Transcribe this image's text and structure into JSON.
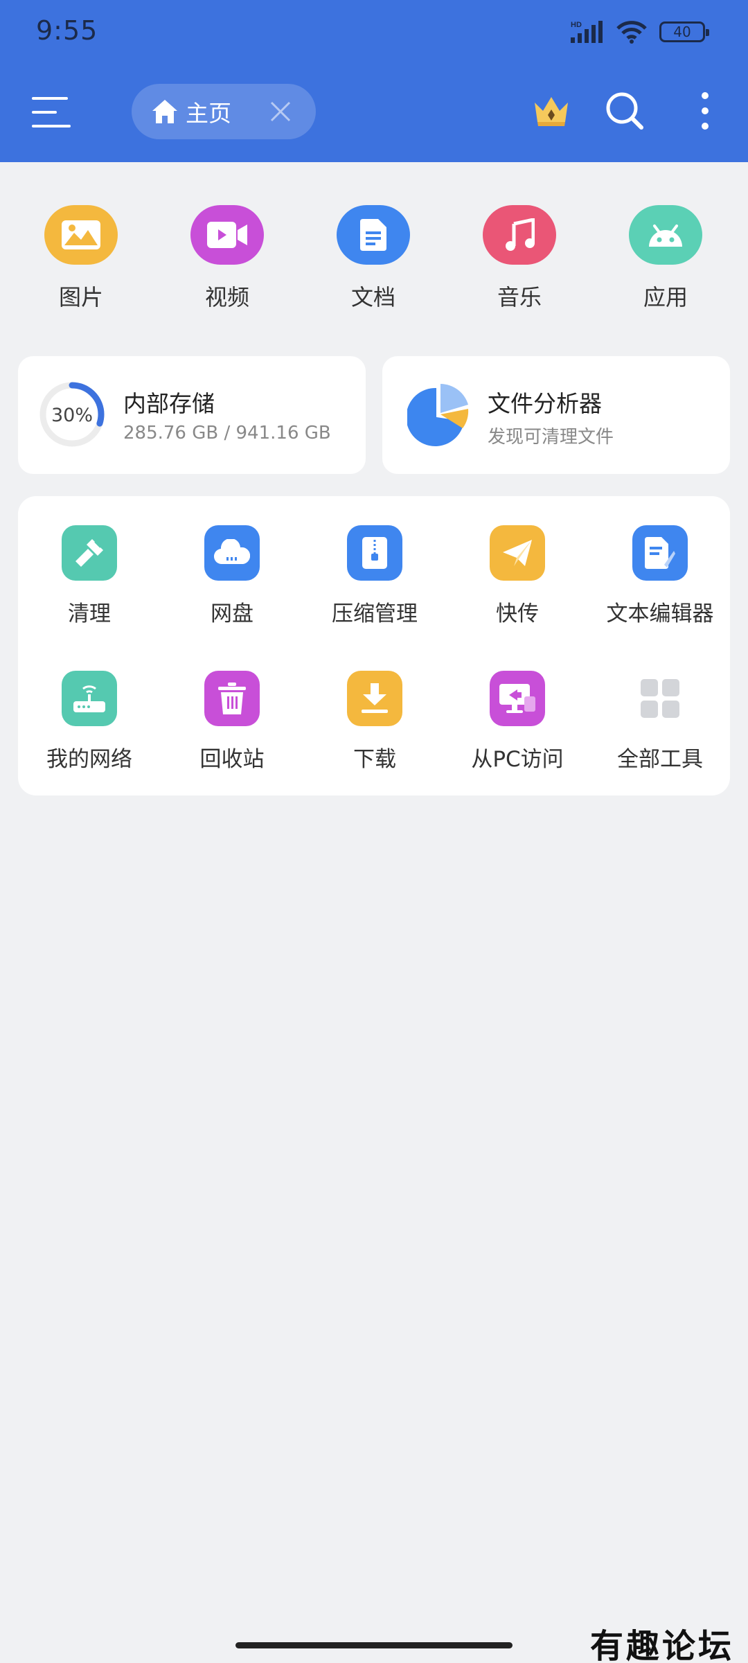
{
  "status_bar": {
    "time": "9:55",
    "battery": "40",
    "network": "HD"
  },
  "header": {
    "tab_label": "主页",
    "icons": [
      "menu-icon",
      "home-icon",
      "close-icon",
      "crown-icon",
      "search-icon",
      "more-vert-icon"
    ],
    "background": "#3d72de"
  },
  "categories": [
    {
      "label": "图片",
      "icon": "image-icon",
      "color": "#f4b83e"
    },
    {
      "label": "视频",
      "icon": "video-icon",
      "color": "#c84fd8"
    },
    {
      "label": "文档",
      "icon": "document-icon",
      "color": "#3f86ef"
    },
    {
      "label": "音乐",
      "icon": "music-icon",
      "color": "#ea5676"
    },
    {
      "label": "应用",
      "icon": "android-icon",
      "color": "#5bd0b5"
    }
  ],
  "storage": {
    "title": "内部存储",
    "used": "285.76 GB / 941.16 GB",
    "percent_label": "30%",
    "percent": 30
  },
  "analyzer": {
    "title": "文件分析器",
    "subtitle": "发现可清理文件"
  },
  "tools": [
    {
      "label": "清理",
      "icon": "broom-icon",
      "color": "#55c9b0"
    },
    {
      "label": "网盘",
      "icon": "cloud-icon",
      "color": "#3f86ef"
    },
    {
      "label": "压缩管理",
      "icon": "zip-icon",
      "color": "#3f86ef"
    },
    {
      "label": "快传",
      "icon": "send-icon",
      "color": "#f4b83e"
    },
    {
      "label": "文本编辑器",
      "icon": "text-edit-icon",
      "color": "#3f86ef"
    },
    {
      "label": "我的网络",
      "icon": "router-icon",
      "color": "#55c9b0"
    },
    {
      "label": "回收站",
      "icon": "trash-icon",
      "color": "#c84fd8"
    },
    {
      "label": "下载",
      "icon": "download-icon",
      "color": "#f4b83e"
    },
    {
      "label": "从PC访问",
      "icon": "pc-access-icon",
      "color": "#c84fd8"
    },
    {
      "label": "全部工具",
      "icon": "grid-icon",
      "color": "#d3d5d9"
    }
  ],
  "watermark": "有趣论坛"
}
